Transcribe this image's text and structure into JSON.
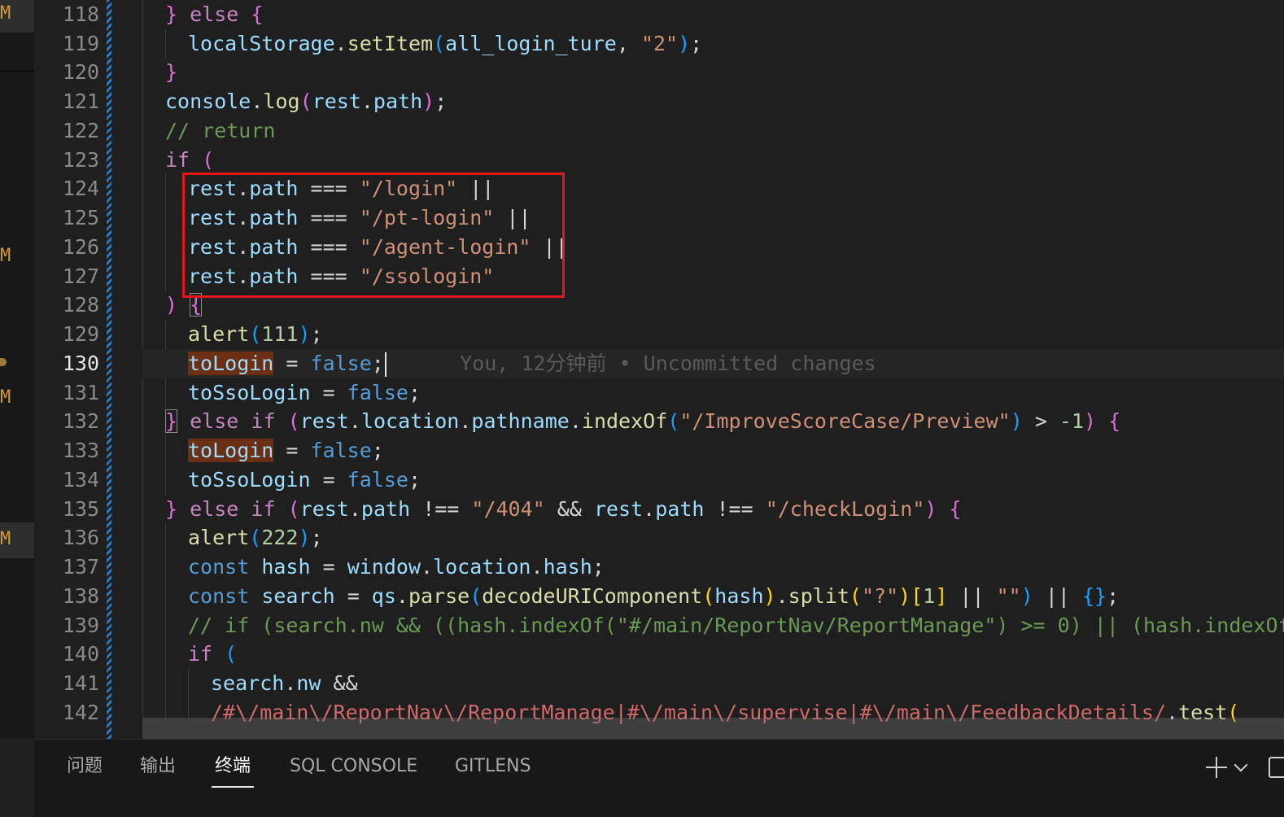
{
  "editor": {
    "current_line": 130,
    "line_numbers": [
      "118",
      "119",
      "120",
      "121",
      "122",
      "123",
      "124",
      "125",
      "126",
      "127",
      "128",
      "129",
      "130",
      "131",
      "132",
      "133",
      "134",
      "135",
      "136",
      "137",
      "138",
      "139",
      "140",
      "141",
      "142"
    ],
    "blame": "You, 12分钟前 • Uncommitted changes",
    "scm_marker": "M"
  },
  "panel": {
    "tabs": [
      "问题",
      "输出",
      "终端",
      "SQL CONSOLE",
      "GITLENS"
    ],
    "active_tab": "终端"
  },
  "colors": {
    "highlight_box": "#e3161c",
    "keyword": "#c586c0",
    "string": "#ce9178",
    "variable": "#9cdcfe",
    "function": "#dcdcaa",
    "comment": "#6a9955"
  },
  "icons": [
    "plus-icon",
    "chevron-down-icon",
    "split-panel-icon"
  ]
}
